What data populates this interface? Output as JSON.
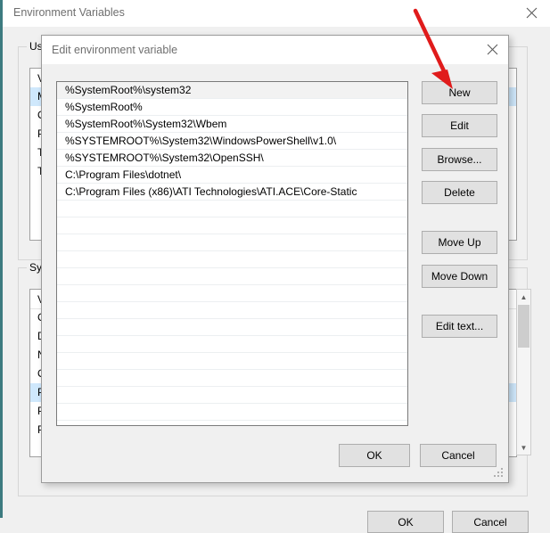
{
  "outer_window": {
    "title": "Environment Variables",
    "close_icon": "close-icon",
    "user_group_label": "User",
    "system_group_label": "Syste",
    "user_table_header": "Va",
    "system_table_header": "Va",
    "user_rows": [
      "M",
      "Or",
      "Pa",
      "TE",
      "TM"
    ],
    "system_rows": [
      "Co",
      "Dr",
      "NU",
      "OS",
      "Pa",
      "PA",
      "PR"
    ],
    "ok_label": "OK",
    "cancel_label": "Cancel"
  },
  "modal": {
    "title": "Edit environment variable",
    "close_icon": "close-icon",
    "path_entries": [
      "%SystemRoot%\\system32",
      "%SystemRoot%",
      "%SystemRoot%\\System32\\Wbem",
      "%SYSTEMROOT%\\System32\\WindowsPowerShell\\v1.0\\",
      "%SYSTEMROOT%\\System32\\OpenSSH\\",
      "C:\\Program Files\\dotnet\\",
      "C:\\Program Files (x86)\\ATI Technologies\\ATI.ACE\\Core-Static"
    ],
    "empty_row_count": 13,
    "buttons": {
      "new": "New",
      "edit": "Edit",
      "browse": "Browse...",
      "delete": "Delete",
      "move_up": "Move Up",
      "move_down": "Move Down",
      "edit_text": "Edit text...",
      "ok": "OK",
      "cancel": "Cancel"
    },
    "resize_grip_icon": "resize-grip-icon"
  },
  "annotation": {
    "arrow_icon": "red-arrow-icon",
    "arrow_color": "#e01b1b",
    "points_at": "New"
  },
  "colors": {
    "window_background": "#f0f0f0",
    "titlebar": "#ffffff",
    "accent_border": "#3d7b80",
    "button_face": "#e1e1e1",
    "button_border": "#adadad",
    "list_background": "#ffffff",
    "selected_row": "#f2f2f2",
    "title_text": "#6f6f6f"
  }
}
